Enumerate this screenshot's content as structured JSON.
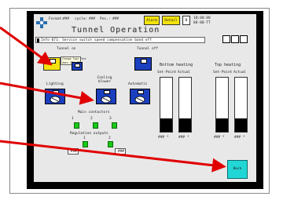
{
  "header": {
    "format_label": "Format:",
    "format_value": "###",
    "cycle_label": "cycle:",
    "cycle_value": "###",
    "pos_label": "Pos.:",
    "pos_value": "###",
    "alarm_label": "Alarm",
    "detail_label": "Detail",
    "b_label": "B",
    "time": "18:88:88",
    "date": "88-88-TT",
    "title": "Tunnel Operation",
    "info_text": "Info 071: Service switch speed compensation band off"
  },
  "controls": {
    "tunnel_on": "Tunnel on",
    "tunnel_off": "Tunnel off",
    "change_type": "Change Type Test",
    "open_cf": "Open CF",
    "in_cf": "In CF",
    "lighting": "Lighting",
    "cooling_blower": "Cooling blower",
    "automatic": "Automatic",
    "main_contactors": "Main contactors",
    "regulation_outputs": "Regulation outputs",
    "contactor_1": "1",
    "contactor_2": "2",
    "contactor_3": "3",
    "regulation_1": "1",
    "regulation_2": "2",
    "regulation_val_1": "###",
    "regulation_val_2": "###"
  },
  "heating": {
    "bottom_title": "Bottom heating",
    "top_title": "Top heating",
    "set_point": "Set-Point",
    "actual": "Actual",
    "bottom_set_value": "### *",
    "bottom_actual_value": "### *",
    "top_set_value": "### *",
    "top_actual_value": "### *",
    "bottom_set_level": 0.25,
    "bottom_actual_level": 0.25,
    "top_set_level": 0.25,
    "top_actual_level": 0.25
  },
  "footer": {
    "back_label": "Back"
  },
  "colors": {
    "alarm_yellow": "#f3e20d",
    "detail_yellow": "#f3e20d",
    "button_blue": "#1a3fbf",
    "contactor_green": "#18c818",
    "back_cyan": "#22d6d6",
    "arrow_red": "#e00000"
  },
  "icons": {
    "logo": "cross-star-icon",
    "tunnel_on": "yellow-on-icon",
    "cooling": "fan-icon",
    "lighting": "lamp-icon"
  }
}
